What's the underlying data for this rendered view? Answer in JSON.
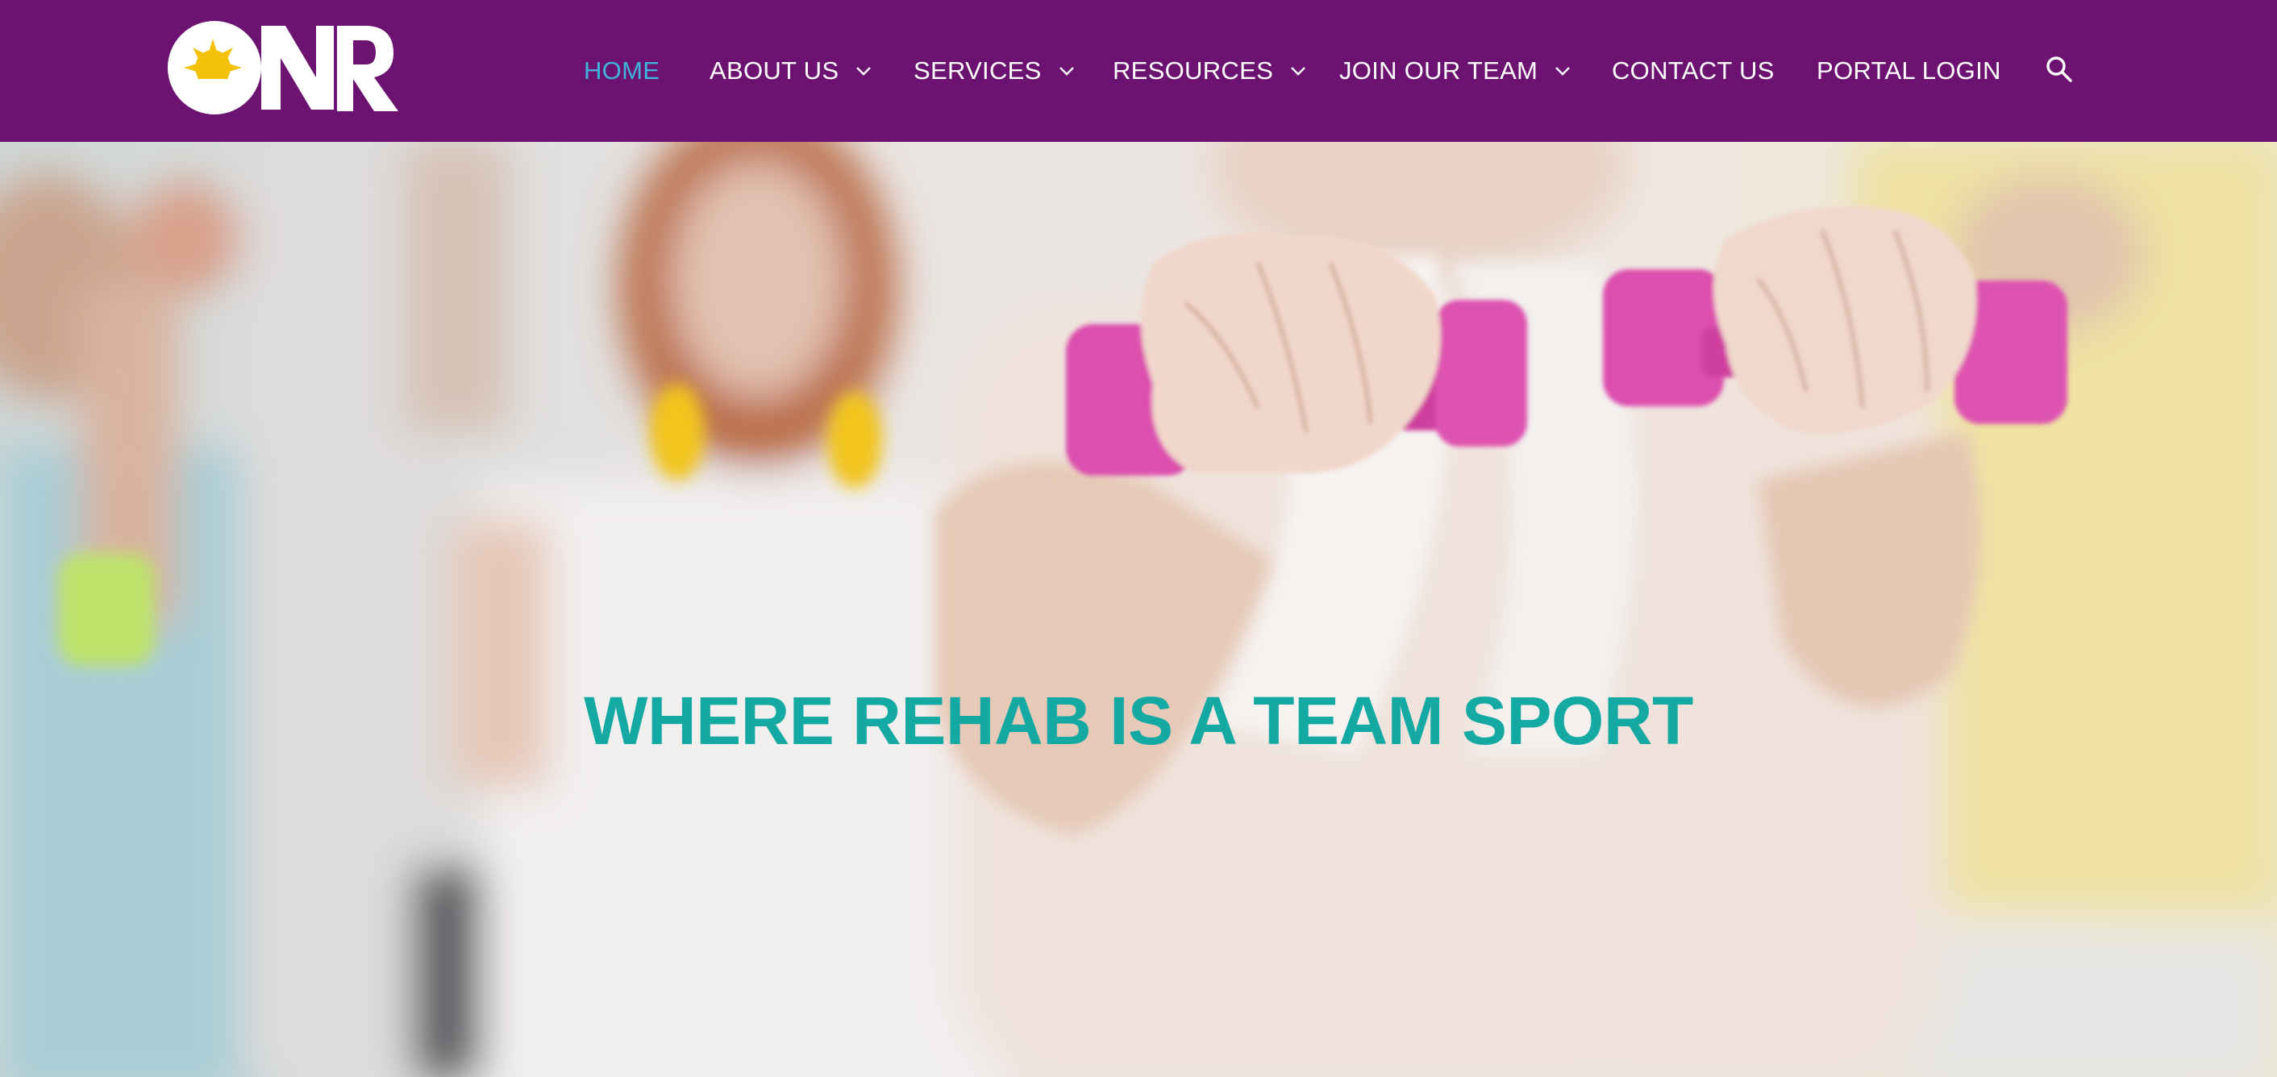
{
  "header": {
    "logo_text": "ONR",
    "nav": [
      {
        "label": "HOME",
        "active": true,
        "dropdown": false
      },
      {
        "label": "ABOUT US",
        "active": false,
        "dropdown": true
      },
      {
        "label": "SERVICES",
        "active": false,
        "dropdown": true
      },
      {
        "label": "RESOURCES",
        "active": false,
        "dropdown": true
      },
      {
        "label": "JOIN OUR TEAM",
        "active": false,
        "dropdown": true
      },
      {
        "label": "CONTACT US",
        "active": false,
        "dropdown": false
      },
      {
        "label": "PORTAL LOGIN",
        "active": false,
        "dropdown": false
      }
    ],
    "search_icon": "search-icon"
  },
  "hero": {
    "title": "WHERE REHAB IS A TEAM SPORT"
  },
  "colors": {
    "header_bg": "#6c1270",
    "nav_text": "#ffffff",
    "nav_active": "#3fb4dd",
    "hero_title": "#14a9a3",
    "dumbbell_pink": "#dc4fae",
    "logo_sun": "#f4c20d"
  }
}
